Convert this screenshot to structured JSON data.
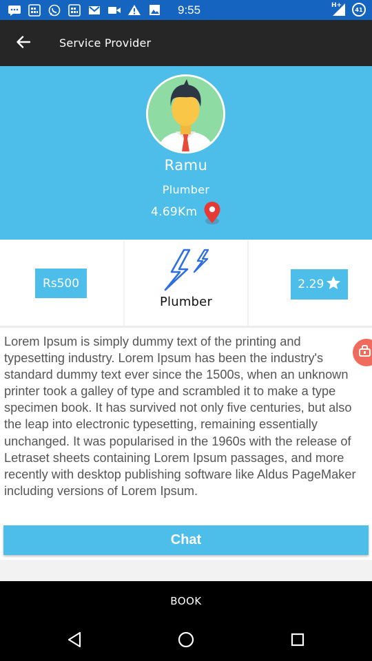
{
  "status_bar": {
    "time": "9:55",
    "left_icons": [
      "chat-icon",
      "sms-icon",
      "whatsapp-icon",
      "sms-icon",
      "gmail-icon",
      "video-icon",
      "warning-icon",
      "image-icon"
    ],
    "network_label": "H+",
    "battery_level": "41"
  },
  "toolbar": {
    "title": "Service Provider",
    "back_icon": "arrow-back-icon"
  },
  "profile": {
    "name": "Ramu",
    "profession": "Plumber",
    "distance": "4.69Km",
    "avatar_icon": "avatar-icon",
    "pin_icon": "location-pin-icon"
  },
  "info": {
    "price": "Rs500",
    "service_icon": "lightning-icon",
    "service": "Plumber",
    "rating": "2.29",
    "rating_icon": "star-icon"
  },
  "description": "Lorem Ipsum is simply dummy text of the printing and typesetting industry. Lorem Ipsum has been the industry's standard dummy text ever since the 1500s, when an unknown printer took a galley of type and scrambled it to make a type specimen book. It has survived not only five centuries, but also the leap into electronic typesetting, remaining essentially unchanged. It was popularised in the 1960s with the release of Letraset sheets containing Lorem Ipsum passages, and more recently with desktop publishing software like Aldus PageMaker including versions of Lorem Ipsum.",
  "chat_label": "Chat",
  "book_label": "BOOK",
  "colors": {
    "status_bar": "#1565c0",
    "toolbar": "#262626",
    "accent": "#4dbde9",
    "pin": "#e53935",
    "fab": "#ef6b5e"
  },
  "nav": {
    "back_icon": "nav-back-icon",
    "home_icon": "nav-home-icon",
    "recents_icon": "nav-recents-icon"
  }
}
